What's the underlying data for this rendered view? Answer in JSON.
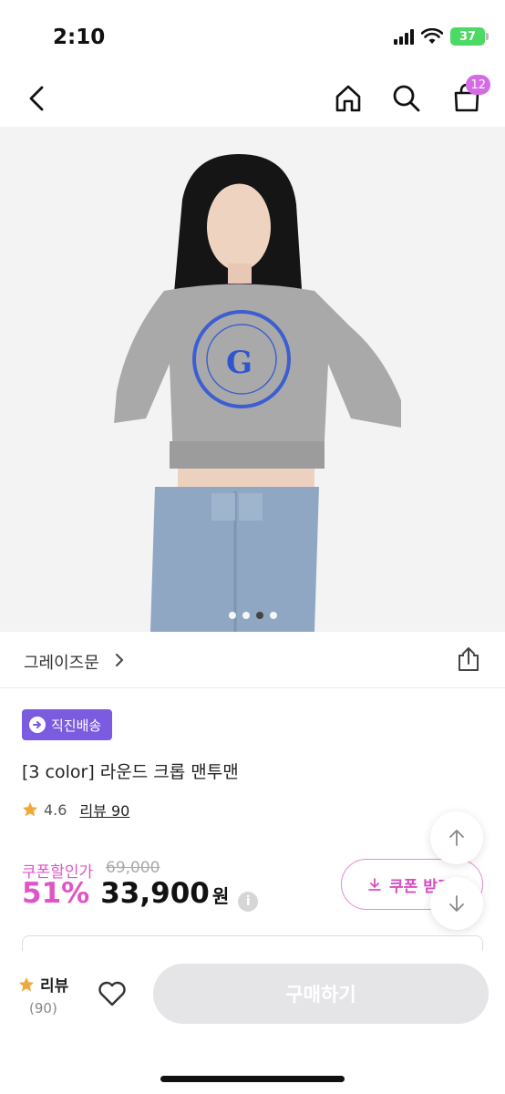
{
  "status_bar": {
    "time": "2:10",
    "battery": "37"
  },
  "nav": {
    "cart_count": "12"
  },
  "hero": {
    "image_count": 4,
    "active_index": 2
  },
  "brand": {
    "name": "그레이즈문"
  },
  "product": {
    "delivery_badge": "직진배송",
    "name": "[3 color] 라운드 크롭 맨투맨",
    "rating": "4.6",
    "review_link": "리뷰 90"
  },
  "price": {
    "label": "쿠폰할인가",
    "original": "69,000",
    "discount": "51%",
    "amount": "33,900",
    "currency": "원",
    "info": "i"
  },
  "coupon": {
    "label": "쿠폰 받기"
  },
  "bottom_bar": {
    "review_label": "리뷰",
    "review_count": "(90)",
    "buy_label": "구매하기"
  },
  "colors": {
    "accent": "#e055c6",
    "badge": "#7b5ce0",
    "cart_badge": "#d46be5",
    "star": "#f0a83a"
  }
}
